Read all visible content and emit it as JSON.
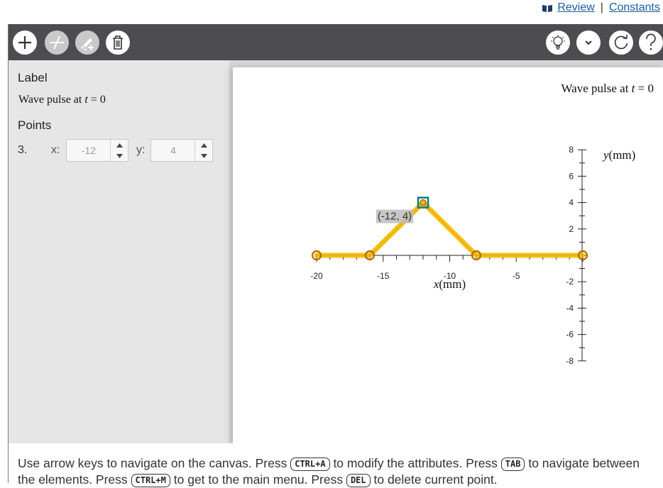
{
  "header": {
    "review_label": "Review",
    "separator": "|",
    "constants_label": "Constants"
  },
  "toolbar": {
    "left_buttons": [
      "add-point",
      "delete-segment",
      "add-label",
      "trash"
    ],
    "right_buttons": [
      "hint",
      "dropdown",
      "reset",
      "help"
    ]
  },
  "panel": {
    "label_heading": "Label",
    "label_value_prefix": "Wave pulse at ",
    "label_value_var": "t",
    "label_value_suffix": " = 0",
    "points_heading": "Points",
    "point_index": "3.",
    "x_label": "x:",
    "x_value": "-12",
    "y_label": "y:",
    "y_value": "4"
  },
  "graph": {
    "title_prefix": "Wave pulse at ",
    "title_var": "t",
    "title_suffix": " = 0",
    "tooltip": "(-12, 4)",
    "colors": {
      "line": "#f5b800",
      "marker": "#b26b00",
      "selected": "#0a7a8a"
    }
  },
  "chart_data": {
    "type": "line",
    "x": [
      -20,
      -16,
      -12,
      -8,
      0
    ],
    "y": [
      0,
      0,
      4,
      0,
      0
    ],
    "xlabel_var": "x",
    "xlabel_unit": "(mm)",
    "ylabel_var": "y",
    "ylabel_unit": "(mm)",
    "xlim": [
      -20,
      0
    ],
    "ylim": [
      -8,
      8
    ],
    "x_tick_labels": [
      "-20",
      "-15",
      "-10",
      "-5"
    ],
    "x_tick_values": [
      -20,
      -15,
      -10,
      -5
    ],
    "y_tick_labels": [
      "8",
      "6",
      "4",
      "2",
      "-2",
      "-4",
      "-6",
      "-8"
    ],
    "y_tick_values": [
      8,
      6,
      4,
      2,
      -2,
      -4,
      -6,
      -8
    ],
    "selected_point_index": 2
  },
  "help": {
    "t1": "Use arrow keys to navigate on the canvas. Press ",
    "k1": "CTRL+A",
    "t2": " to modify the attributes. Press ",
    "k2": "TAB",
    "t3": " to navigate between the elements. Press ",
    "k3": "CTRL+M",
    "t4": " to get to the main menu. Press ",
    "k4": "DEL",
    "t5": " to delete current point."
  }
}
